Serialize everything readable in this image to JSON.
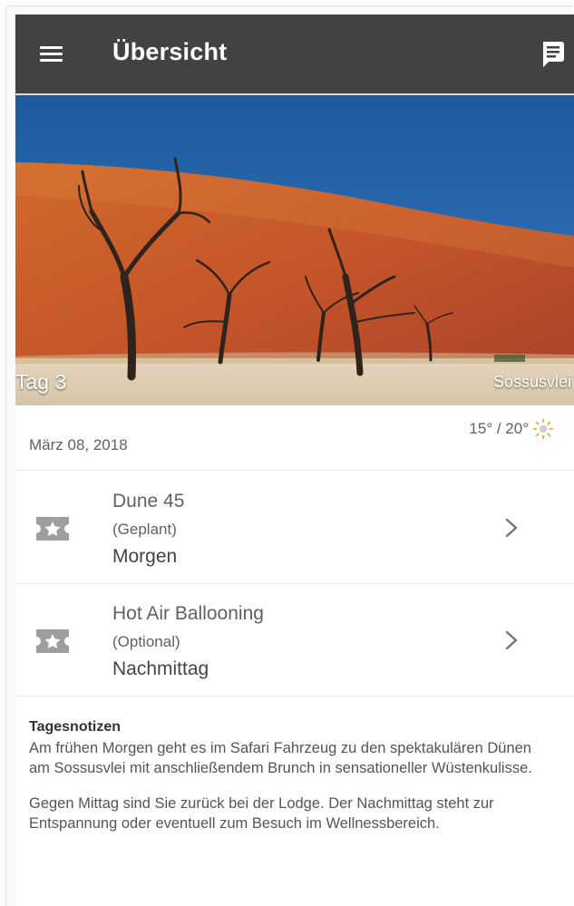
{
  "appbar": {
    "title": "Übersicht",
    "menu_icon": "hamburger-menu-icon",
    "chat_icon": "chat-message-icon",
    "background": "#424242"
  },
  "hero": {
    "day_label": "Tag 3",
    "place_label": "Sossusvlei",
    "image_description_icon": "desert-dune-photo"
  },
  "day": {
    "date": "März 08, 2018",
    "temperature": "15° / 20°",
    "weather_icon": "sunny-icon"
  },
  "activities": [
    {
      "name": "Dune 45",
      "status": "(Geplant)",
      "time": "Morgen",
      "icon": "star-ticket-icon"
    },
    {
      "name": "Hot Air Ballooning",
      "status": "(Optional)",
      "time": "Nachmittag",
      "icon": "star-ticket-icon"
    }
  ],
  "notes": {
    "title": "Tagesnotizen",
    "paragraphs": [
      "Am frühen Morgen geht es im Safari Fahrzeug zu den spektakulären Dünen am Sossusvlei mit anschließendem Brunch in sensationeller Wüstenkulisse.",
      "Gegen Mittag sind Sie zurück bei der Lodge. Der Nachmittag steht zur Entspannung oder eventuell zum Besuch im Wellnessbereich."
    ]
  }
}
